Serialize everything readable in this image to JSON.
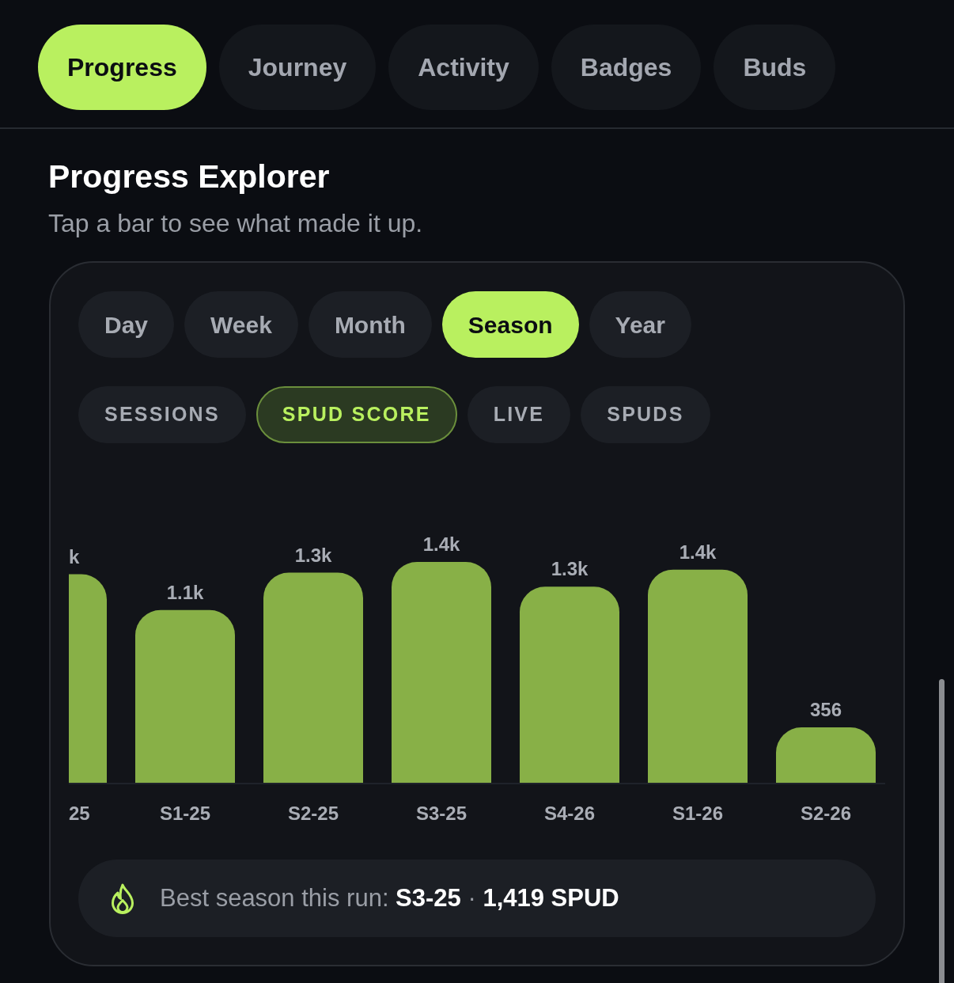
{
  "tabs": [
    {
      "label": "Progress",
      "selected": true
    },
    {
      "label": "Journey",
      "selected": false
    },
    {
      "label": "Activity",
      "selected": false
    },
    {
      "label": "Badges",
      "selected": false
    },
    {
      "label": "Buds",
      "selected": false
    }
  ],
  "section": {
    "title": "Progress Explorer",
    "subtitle": "Tap a bar to see what made it up."
  },
  "explorer": {
    "periods": [
      {
        "label": "Day",
        "selected": false
      },
      {
        "label": "Week",
        "selected": false
      },
      {
        "label": "Month",
        "selected": false
      },
      {
        "label": "Season",
        "selected": true
      },
      {
        "label": "Year",
        "selected": false
      }
    ],
    "metrics": [
      {
        "label": "SESSIONS",
        "selected": false
      },
      {
        "label": "SPUD SCORE",
        "selected": true
      },
      {
        "label": "LIVE",
        "selected": false
      },
      {
        "label": "SPUDS",
        "selected": false
      }
    ],
    "chart_data": {
      "type": "bar",
      "categories": [
        "25",
        "S1-25",
        "S2-25",
        "S3-25",
        "S4-26",
        "S1-26",
        "S2-26"
      ],
      "values": [
        1340,
        1110,
        1350,
        1419,
        1260,
        1370,
        356
      ],
      "value_labels": [
        "k",
        "1.1k",
        "1.3k",
        "1.4k",
        "1.3k",
        "1.4k",
        "356"
      ]
    },
    "summary": {
      "text": "Best season this run: **S3-25** · **1,419 SPUD**"
    }
  }
}
